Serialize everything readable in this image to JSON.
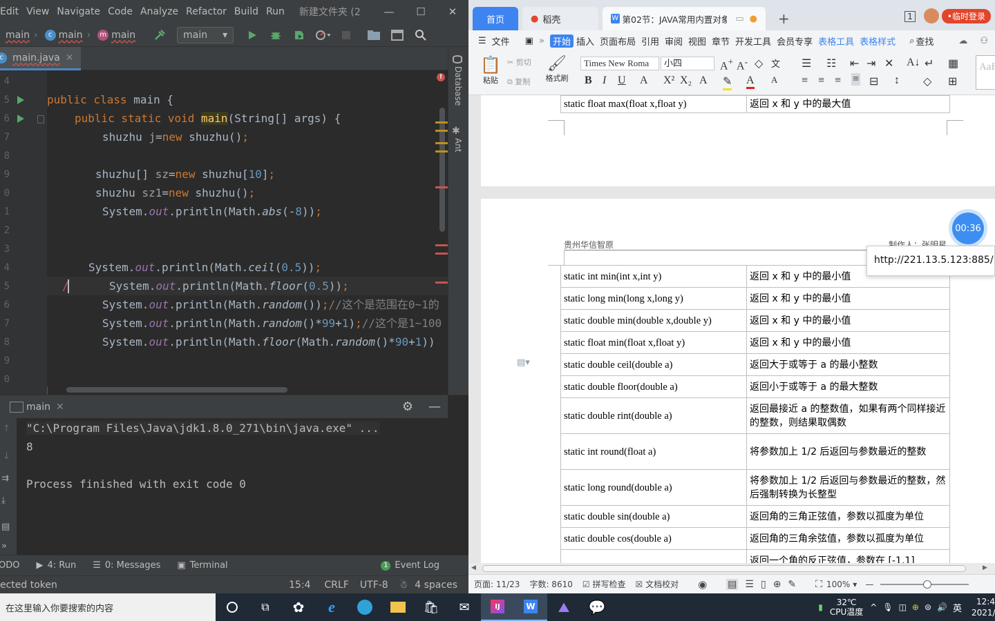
{
  "ide": {
    "menu": [
      "Edit",
      "View",
      "Navigate",
      "Code",
      "Analyze",
      "Refactor",
      "Build",
      "Run"
    ],
    "project_title": "新建文件夹 (2",
    "window_controls": {
      "minimize": "—",
      "maximize": "☐",
      "close": "✕"
    },
    "breadcrumbs": [
      "main",
      "main",
      "main"
    ],
    "run_config": "main",
    "file_tab": "main.java",
    "side_tools": [
      "Database",
      "Ant"
    ],
    "line_numbers": [
      "4",
      "5",
      "6",
      "7",
      "8",
      "9",
      "0",
      "1",
      "2",
      "3",
      "4",
      "5",
      "6",
      "7",
      "8",
      "9",
      "0"
    ],
    "console_lines": [
      "\"C:\\Program Files\\Java\\jdk1.8.0_271\\bin\\java.exe\" ...",
      "8",
      "",
      "Process finished with exit code 0"
    ],
    "run_tab": "main",
    "bottom_tabs": [
      "ODO",
      "4: Run",
      "0: Messages",
      "Terminal"
    ],
    "event_log": "Event Log",
    "event_badge": "1",
    "status": {
      "message": "ected token",
      "position": "15:4",
      "line_sep": "CRLF",
      "encoding": "UTF-8",
      "indent": "4 spaces"
    }
  },
  "wps": {
    "tabs": {
      "home": "首页",
      "daoke": "稻壳",
      "doc": "第02节：JAVA常用内置对象"
    },
    "login": "临时登录",
    "ribbon_tabs": [
      "文件",
      "开始",
      "插入",
      "页面布局",
      "引用",
      "审阅",
      "视图",
      "章节",
      "开发工具",
      "会员专享",
      "表格工具",
      "表格样式"
    ],
    "search": "查找",
    "font_name": "Times New Roma",
    "font_size": "小四",
    "clipboard": {
      "paste": "粘贴",
      "cut": "剪切",
      "copy": "复制",
      "format_painter": "格式刷"
    },
    "styles_label": "AaB",
    "header_left": "贵州华信智原",
    "header_right": "制作人：张明星",
    "top_row": [
      "static float max(float x,float y)",
      "返回 x 和 y 中的最大值"
    ],
    "rows": [
      [
        "static int min(int x,int y)",
        "返回 x 和 y 中的最小值"
      ],
      [
        "static long min(long x,long y)",
        "返回 x 和 y 中的最小值"
      ],
      [
        "static double min(double x,double y)",
        "返回 x 和 y 中的最小值"
      ],
      [
        "static float min(float x,float y)",
        "返回 x 和 y 中的最小值"
      ],
      [
        "static double ceil(double a)",
        "返回大于或等于 a 的最小整数"
      ],
      [
        "static double floor(double a)",
        "返回小于或等于 a 的最大整数"
      ],
      [
        "static double rint(double a)",
        "返回最接近 a 的整数值，如果有两个同样接近的整数，则结果取偶数"
      ],
      [
        "static int round(float a)",
        "将参数加上 1/2 后返回与参数最近的整数"
      ],
      [
        "static long round(double a)",
        "将参数加上 1/2 后返回与参数最近的整数，然后强制转换为长整型"
      ],
      [
        "static double sin(double a)",
        "返回角的三角正弦值，参数以孤度为单位"
      ],
      [
        "static double cos(double a)",
        "返回角的三角余弦值，参数以孤度为单位"
      ],
      [
        "",
        "返回一个角的反正弦值，参数在 [-1,1]"
      ]
    ],
    "timer": "00:36",
    "url_tooltip": "http://221.13.5.123:885/",
    "status": {
      "page": "页面: 11/23",
      "words": "字数: 8610",
      "spell": "拼写检查",
      "proof": "文档校对",
      "zoom": "100%"
    }
  },
  "taskbar": {
    "search_placeholder": "在这里输入你要搜索的内容",
    "temp": "32℃",
    "temp_label": "CPU温度",
    "ime": "英",
    "time": "12:4",
    "date": "2021/3"
  }
}
